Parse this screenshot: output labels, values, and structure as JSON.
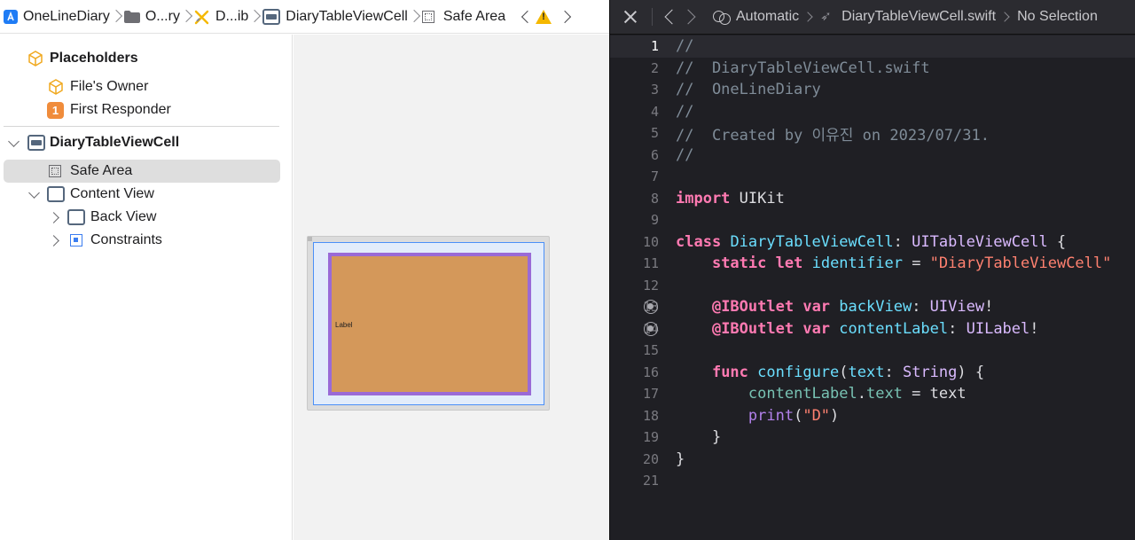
{
  "left_jumpbar": {
    "items": [
      "OneLineDiary",
      "O...ry",
      "D...ib",
      "DiaryTableViewCell",
      "Safe Area"
    ]
  },
  "outline": {
    "placeholders": "Placeholders",
    "files_owner": "File's Owner",
    "first_responder": "First Responder",
    "first_responder_badge": "1",
    "cell": "DiaryTableViewCell",
    "safe_area": "Safe Area",
    "content_view": "Content View",
    "back_view": "Back View",
    "constraints": "Constraints"
  },
  "canvas": {
    "label_text": "Label",
    "colors": {
      "back_view": "#d4985a",
      "back_view_border": "#9a6ad6",
      "safe_area": "#e2ecfb"
    }
  },
  "right_jumpbar": {
    "scheme": "Automatic",
    "file": "DiaryTableViewCell.swift",
    "selection": "No Selection"
  },
  "editor": {
    "current_line": 1,
    "lines": [
      {
        "n": "1",
        "outlet": false,
        "tokens": [
          [
            "c",
            "//"
          ]
        ]
      },
      {
        "n": "2",
        "outlet": false,
        "tokens": [
          [
            "c",
            "//  DiaryTableViewCell.swift"
          ]
        ]
      },
      {
        "n": "3",
        "outlet": false,
        "tokens": [
          [
            "c",
            "//  OneLineDiary"
          ]
        ]
      },
      {
        "n": "4",
        "outlet": false,
        "tokens": [
          [
            "c",
            "//"
          ]
        ]
      },
      {
        "n": "5",
        "outlet": false,
        "tokens": [
          [
            "c",
            "//  Created by 이유진 on 2023/07/31."
          ]
        ]
      },
      {
        "n": "6",
        "outlet": false,
        "tokens": [
          [
            "c",
            "//"
          ]
        ]
      },
      {
        "n": "7",
        "outlet": false,
        "tokens": []
      },
      {
        "n": "8",
        "outlet": false,
        "tokens": [
          [
            "k",
            "import"
          ],
          [
            "p",
            " UIKit"
          ]
        ]
      },
      {
        "n": "9",
        "outlet": false,
        "tokens": []
      },
      {
        "n": "10",
        "outlet": false,
        "tokens": [
          [
            "k",
            "class"
          ],
          [
            "p",
            " "
          ],
          [
            "d",
            "DiaryTableViewCell"
          ],
          [
            "p",
            ": "
          ],
          [
            "t",
            "UITableViewCell"
          ],
          [
            "p",
            " {"
          ]
        ]
      },
      {
        "n": "11",
        "outlet": false,
        "tokens": [
          [
            "p",
            "    "
          ],
          [
            "k",
            "static"
          ],
          [
            "p",
            " "
          ],
          [
            "k",
            "let"
          ],
          [
            "p",
            " "
          ],
          [
            "d",
            "identifier"
          ],
          [
            "p",
            " = "
          ],
          [
            "s",
            "\"DiaryTableViewCell\""
          ]
        ]
      },
      {
        "n": "12",
        "outlet": false,
        "tokens": []
      },
      {
        "n": "13",
        "outlet": true,
        "tokens": [
          [
            "p",
            "    "
          ],
          [
            "a",
            "@IBOutlet"
          ],
          [
            "p",
            " "
          ],
          [
            "k",
            "var"
          ],
          [
            "p",
            " "
          ],
          [
            "d",
            "backView"
          ],
          [
            "p",
            ": "
          ],
          [
            "t",
            "UIView"
          ],
          [
            "p",
            "!"
          ]
        ]
      },
      {
        "n": "14",
        "outlet": true,
        "tokens": [
          [
            "p",
            "    "
          ],
          [
            "a",
            "@IBOutlet"
          ],
          [
            "p",
            " "
          ],
          [
            "k",
            "var"
          ],
          [
            "p",
            " "
          ],
          [
            "d",
            "contentLabel"
          ],
          [
            "p",
            ": "
          ],
          [
            "t",
            "UILabel"
          ],
          [
            "p",
            "!"
          ]
        ]
      },
      {
        "n": "15",
        "outlet": false,
        "tokens": []
      },
      {
        "n": "16",
        "outlet": false,
        "tokens": [
          [
            "p",
            "    "
          ],
          [
            "k",
            "func"
          ],
          [
            "p",
            " "
          ],
          [
            "d",
            "configure"
          ],
          [
            "p",
            "("
          ],
          [
            "d",
            "text"
          ],
          [
            "p",
            ": "
          ],
          [
            "t",
            "String"
          ],
          [
            "p",
            ") {"
          ]
        ]
      },
      {
        "n": "17",
        "outlet": false,
        "tokens": [
          [
            "p",
            "        "
          ],
          [
            "r",
            "contentLabel"
          ],
          [
            "p",
            "."
          ],
          [
            "r",
            "text"
          ],
          [
            "p",
            " = text"
          ]
        ]
      },
      {
        "n": "18",
        "outlet": false,
        "tokens": [
          [
            "p",
            "        "
          ],
          [
            "f",
            "print"
          ],
          [
            "p",
            "("
          ],
          [
            "s",
            "\"D\""
          ],
          [
            "p",
            ")"
          ]
        ]
      },
      {
        "n": "19",
        "outlet": false,
        "tokens": [
          [
            "p",
            "    }"
          ]
        ]
      },
      {
        "n": "20",
        "outlet": false,
        "tokens": [
          [
            "p",
            "}"
          ]
        ]
      },
      {
        "n": "21",
        "outlet": false,
        "tokens": []
      }
    ]
  }
}
